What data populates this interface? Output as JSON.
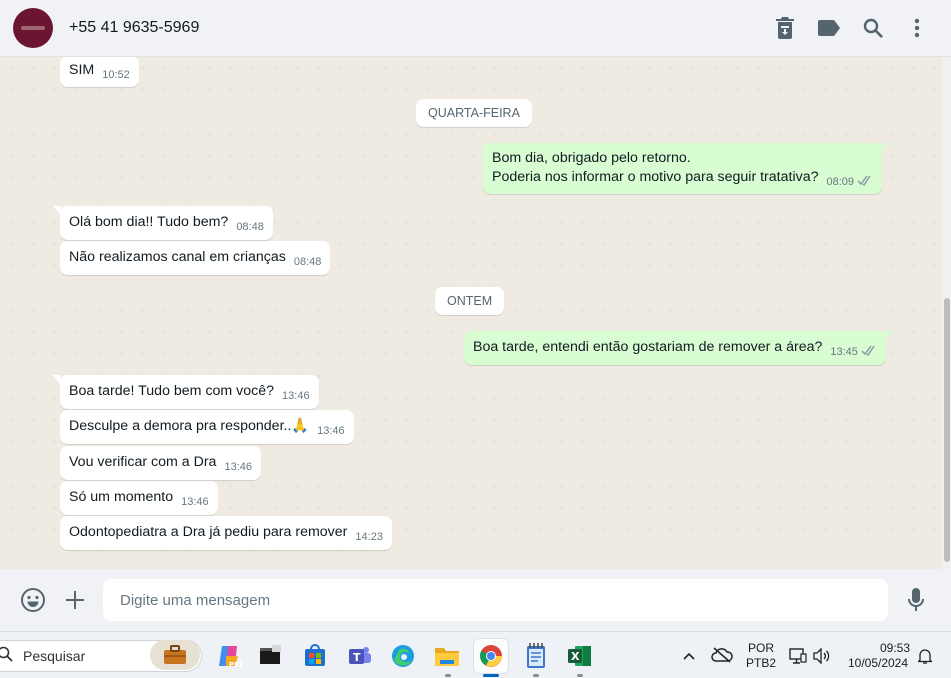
{
  "header": {
    "contact_name": "+55 41 9635-5969"
  },
  "days": {
    "wednesday": "QUARTA-FEIRA",
    "yesterday": "ONTEM"
  },
  "messages": [
    {
      "text": "SIM",
      "time": "10:52",
      "direction": "in"
    },
    {
      "line1": "Bom dia, obrigado pelo retorno.",
      "line2": "Poderia nos informar o motivo para seguir tratativa?",
      "time": "08:09",
      "direction": "out"
    },
    {
      "text": "Olá bom dia!! Tudo bem?",
      "time": "08:48",
      "direction": "in"
    },
    {
      "text": "Não realizamos canal em crianças",
      "time": "08:48",
      "direction": "in"
    },
    {
      "text": "Boa tarde, entendi então gostariam de remover a área?",
      "time": "13:45",
      "direction": "out"
    },
    {
      "text": "Boa tarde! Tudo bem com você?",
      "time": "13:46",
      "direction": "in"
    },
    {
      "text": "Desculpe a demora pra responder..",
      "emoji": "🙏",
      "time": "13:46",
      "direction": "in"
    },
    {
      "text": "Vou verificar com a Dra",
      "time": "13:46",
      "direction": "in"
    },
    {
      "text": "Só um momento",
      "time": "13:46",
      "direction": "in"
    },
    {
      "text": "Odontopediatra a Dra já pediu para remover",
      "time": "14:23",
      "direction": "in"
    }
  ],
  "composer": {
    "placeholder": "Digite uma mensagem"
  },
  "taskbar": {
    "search_label": "Pesquisar",
    "language_line1": "POR",
    "language_line2": "PTB2",
    "clock_time": "09:53",
    "clock_date": "10/05/2024",
    "apps": [
      "work-briefcase",
      "copilot-pre",
      "terminal",
      "microsoft-store",
      "teams",
      "edge",
      "file-explorer",
      "chrome",
      "notepad",
      "excel"
    ]
  },
  "colors": {
    "outgoing_bubble": "#d9fdd3",
    "incoming_bubble": "#ffffff",
    "chat_background": "#efeae2",
    "read_ticks": "#8696a0"
  }
}
